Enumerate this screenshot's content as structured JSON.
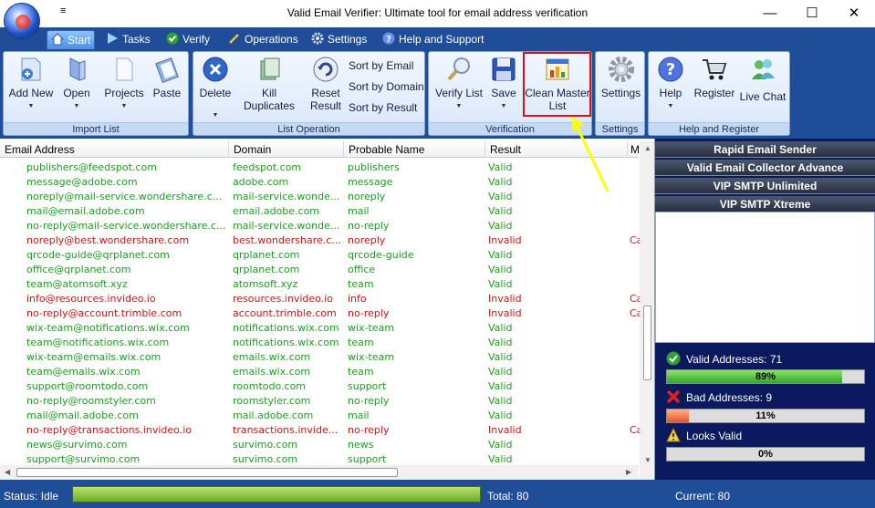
{
  "window": {
    "title": "Valid Email Verifier: Ultimate tool for email address verification",
    "qat_glyph": "≡",
    "minimize": "—",
    "maximize": "☐",
    "close": "✕"
  },
  "tabs": [
    {
      "label": "Start",
      "icon": "home-icon",
      "active": true
    },
    {
      "label": "Tasks",
      "icon": "play-arrow-icon"
    },
    {
      "label": "Verify",
      "icon": "check-icon"
    },
    {
      "label": "Operations",
      "icon": "pencil-icon"
    },
    {
      "label": "Settings",
      "icon": "gear-icon"
    },
    {
      "label": "Help and Support",
      "icon": "help-icon"
    }
  ],
  "ribbon": {
    "import": {
      "label": "Import List",
      "add_new": "Add New",
      "open": "Open",
      "projects": "Projects",
      "paste": "Paste"
    },
    "listop": {
      "label": "List Operation",
      "delete": "Delete",
      "kill_duplicates": "Kill Duplicates",
      "reset_result_1": "Reset",
      "reset_result_2": "Result",
      "sort_email": "Sort by Email",
      "sort_domain": "Sort by Domain",
      "sort_result": "Sort by Result"
    },
    "verification": {
      "label": "Verification",
      "verify_list": "Verify List",
      "save": "Save",
      "clean_master_1": "Clean Master",
      "clean_master_2": "List"
    },
    "settings": {
      "label": "Settings",
      "settings": "Settings"
    },
    "help": {
      "label": "Help and Register",
      "help": "Help",
      "register": "Register",
      "live_chat": "Live Chat"
    },
    "drop_glyph": "▼"
  },
  "table": {
    "headers": [
      "Email Address",
      "Domain",
      "Probable Name",
      "Result",
      "M"
    ],
    "rows": [
      {
        "email": "publishers@feedspot.com",
        "domain": "feedspot.com",
        "name": "publishers",
        "result": "Valid",
        "extra": "",
        "status": "ok"
      },
      {
        "email": "message@adobe.com",
        "domain": "adobe.com",
        "name": "message",
        "result": "Valid",
        "extra": "",
        "status": "ok"
      },
      {
        "email": "noreply@mail-service.wondershare.c...",
        "domain": "mail-service.wonde...",
        "name": "noreply",
        "result": "Valid",
        "extra": "",
        "status": "ok"
      },
      {
        "email": "mail@email.adobe.com",
        "domain": "email.adobe.com",
        "name": "mail",
        "result": "Valid",
        "extra": "",
        "status": "ok"
      },
      {
        "email": "no-reply@mail-service.wondershare.c...",
        "domain": "mail-service.wonde...",
        "name": "no-reply",
        "result": "Valid",
        "extra": "",
        "status": "ok"
      },
      {
        "email": "noreply@best.wondershare.com",
        "domain": "best.wondershare.c...",
        "name": "noreply",
        "result": "Invalid",
        "extra": "Ca",
        "status": "bad"
      },
      {
        "email": "qrcode-guide@qrplanet.com",
        "domain": "qrplanet.com",
        "name": "qrcode-guide",
        "result": "Valid",
        "extra": "",
        "status": "ok"
      },
      {
        "email": "office@qrplanet.com",
        "domain": "qrplanet.com",
        "name": "office",
        "result": "Valid",
        "extra": "",
        "status": "ok"
      },
      {
        "email": "team@atomsoft.xyz",
        "domain": "atomsoft.xyz",
        "name": "team",
        "result": "Valid",
        "extra": "",
        "status": "ok"
      },
      {
        "email": "info@resources.invideo.io",
        "domain": "resources.invideo.io",
        "name": "info",
        "result": "Invalid",
        "extra": "Ca",
        "status": "bad"
      },
      {
        "email": "no-reply@account.trimble.com",
        "domain": "account.trimble.com",
        "name": "no-reply",
        "result": "Invalid",
        "extra": "Ca",
        "status": "bad"
      },
      {
        "email": "wix-team@notifications.wix.com",
        "domain": "notifications.wix.com",
        "name": "wix-team",
        "result": "Valid",
        "extra": "",
        "status": "ok"
      },
      {
        "email": "team@notifications.wix.com",
        "domain": "notifications.wix.com",
        "name": "team",
        "result": "Valid",
        "extra": "",
        "status": "ok"
      },
      {
        "email": "wix-team@emails.wix.com",
        "domain": "emails.wix.com",
        "name": "wix-team",
        "result": "Valid",
        "extra": "",
        "status": "ok"
      },
      {
        "email": "team@emails.wix.com",
        "domain": "emails.wix.com",
        "name": "team",
        "result": "Valid",
        "extra": "",
        "status": "ok"
      },
      {
        "email": "support@roomtodo.com",
        "domain": "roomtodo.com",
        "name": "support",
        "result": "Valid",
        "extra": "",
        "status": "ok"
      },
      {
        "email": "no-reply@roomstyler.com",
        "domain": "roomstyler.com",
        "name": "no-reply",
        "result": "Valid",
        "extra": "",
        "status": "ok"
      },
      {
        "email": "mail@mail.adobe.com",
        "domain": "mail.adobe.com",
        "name": "mail",
        "result": "Valid",
        "extra": "",
        "status": "ok"
      },
      {
        "email": "no-reply@transactions.invideo.io",
        "domain": "transactions.invide...",
        "name": "no-reply",
        "result": "Invalid",
        "extra": "Ca",
        "status": "bad"
      },
      {
        "email": "news@survimo.com",
        "domain": "survimo.com",
        "name": "news",
        "result": "Valid",
        "extra": "",
        "status": "ok"
      },
      {
        "email": "support@survimo.com",
        "domain": "survimo.com",
        "name": "support",
        "result": "Valid",
        "extra": "",
        "status": "ok"
      }
    ]
  },
  "side": {
    "links": [
      "Rapid Email Sender",
      "Valid Email Collector Advance",
      "VIP SMTP Unlimited",
      "VIP SMTP Xtreme"
    ],
    "valid_label": "Valid Addresses: 71",
    "valid_pct_text": "89%",
    "valid_fraction": 0.89,
    "bad_label": "Bad Addresses: 9",
    "bad_pct_text": "11%",
    "bad_fraction": 0.11,
    "looks_label": "Looks Valid",
    "looks_pct_text": "0%",
    "looks_fraction": 0
  },
  "status": {
    "text": "Status: Idle",
    "progress_fraction": 1,
    "total": "Total: 80",
    "current": "Current: 80"
  },
  "colors": {
    "valid": "#17a31a",
    "invalid": "#d81111",
    "ribbon_bg": "#1f4d97",
    "highlight": "#e01010",
    "arrow": "#ffff00"
  }
}
